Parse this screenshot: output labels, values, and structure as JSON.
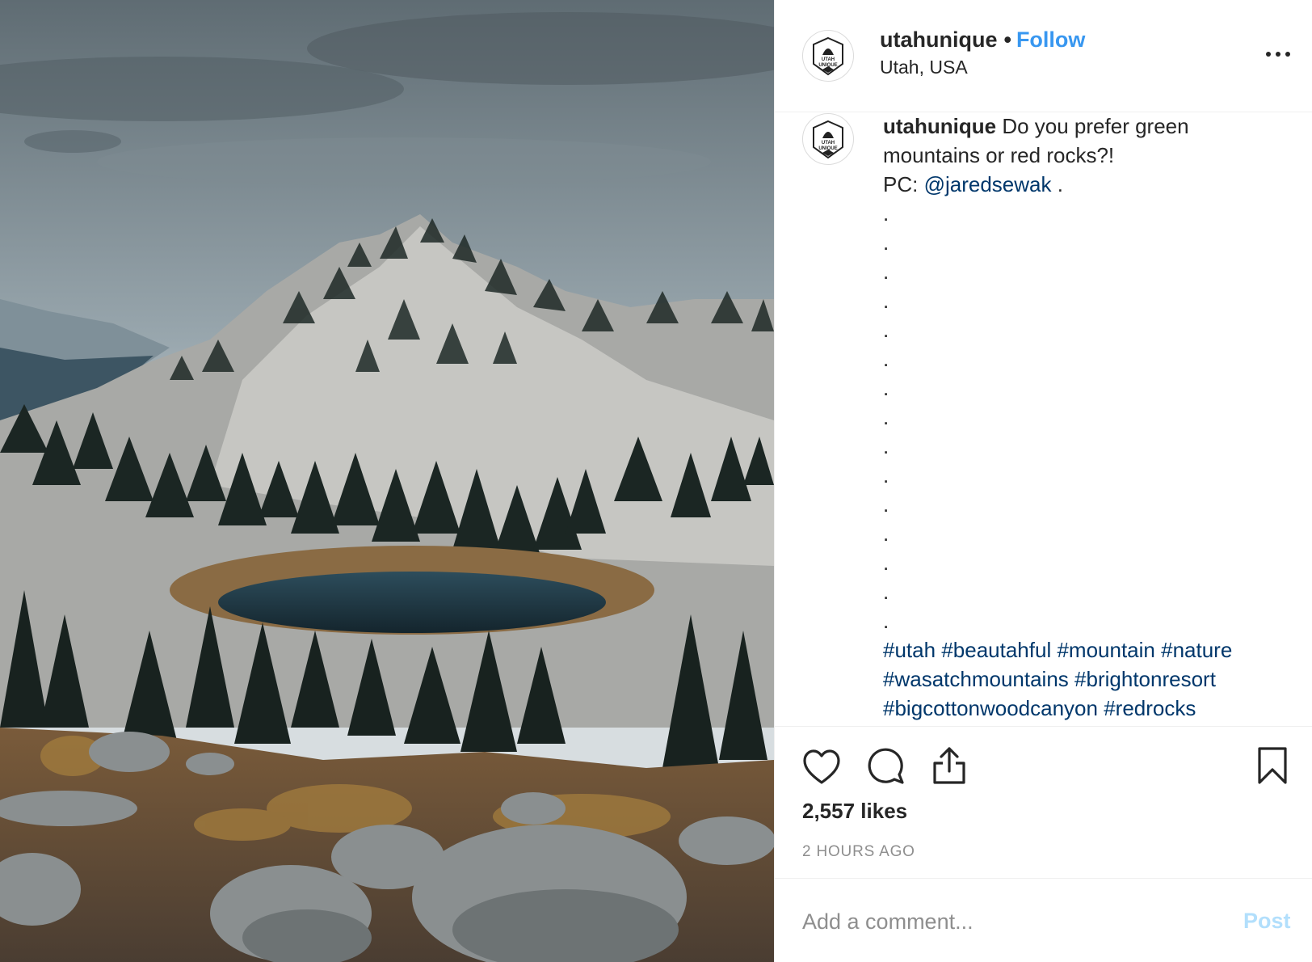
{
  "post": {
    "image_description_icon": "mountain-lake-photo",
    "header": {
      "username": "utahunique",
      "separator": "•",
      "follow_label": "Follow",
      "location": "Utah, USA",
      "avatar_text_top": "UTAH",
      "avatar_text_bottom": "UNIQUE"
    },
    "caption": {
      "username": "utahunique",
      "line1": "Do you prefer green mountains or red rocks?!",
      "pc_prefix": "PC:",
      "mention": "@jaredsewak",
      "pc_suffix": ".",
      "dots": [
        ".",
        ".",
        ".",
        ".",
        ".",
        ".",
        ".",
        ".",
        ".",
        ".",
        ".",
        ".",
        ".",
        ".",
        "."
      ],
      "hashtags": [
        "#utah",
        "#beautahful",
        "#mountain",
        "#nature",
        "#wasatchmountains",
        "#brightonresort",
        "#bigcottonwoodcanyon",
        "#redrocks"
      ]
    },
    "actions": {
      "like_icon": "heart-icon",
      "comment_icon": "comment-icon",
      "share_icon": "share-icon",
      "save_icon": "bookmark-icon"
    },
    "likes": "2,557 likes",
    "timestamp": "2 HOURS AGO",
    "comment_box": {
      "placeholder": "Add a comment...",
      "post_label": "Post"
    },
    "colors": {
      "link_blue": "#3897f0",
      "hashtag_blue": "#00376b",
      "post_disabled": "#b2dffc",
      "muted_text": "#8e8e8e"
    }
  }
}
